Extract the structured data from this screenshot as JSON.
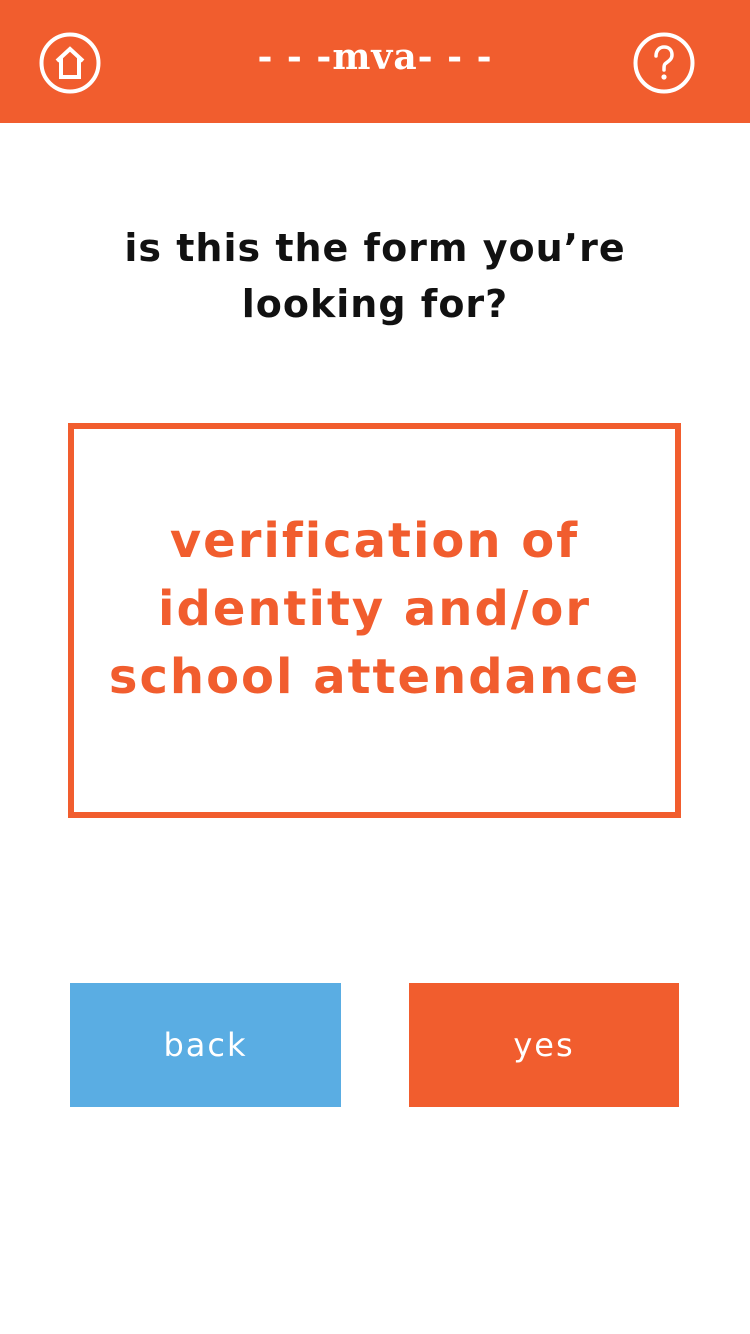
{
  "header": {
    "title": "- - -mva- - -",
    "home_icon": "home-icon",
    "help_icon": "help-icon",
    "background_color": "#F15D2E"
  },
  "main": {
    "question": "is this the form you’re looking for?",
    "form_card": {
      "name": "verification of identity and/or school attendance",
      "accent_color": "#F15D2E"
    }
  },
  "actions": {
    "back_label": "back",
    "yes_label": "yes",
    "back_color": "#5AADE3",
    "yes_color": "#F15D2E"
  }
}
